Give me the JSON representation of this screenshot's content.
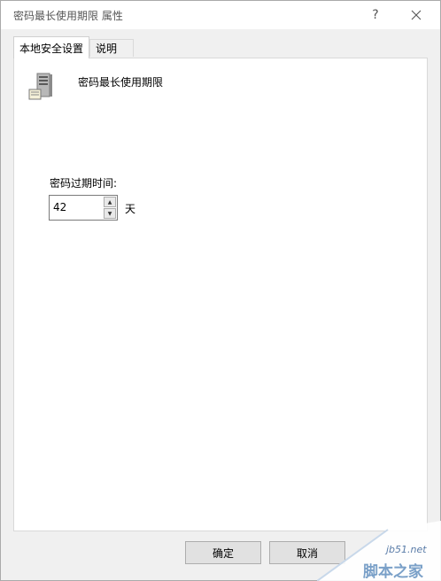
{
  "window": {
    "title": "密码最长使用期限 属性",
    "help_glyph": "?",
    "close_glyph": "✕"
  },
  "tabs": [
    {
      "label": "本地安全设置",
      "active": true
    },
    {
      "label": "说明",
      "active": false
    }
  ],
  "policy": {
    "icon": "server-icon",
    "name": "密码最长使用期限",
    "field_label": "密码过期时间:",
    "value": "42",
    "unit": "天"
  },
  "buttons": {
    "ok": "确定",
    "cancel": "取消"
  },
  "watermark": {
    "url": "jb51.net",
    "site_name": "脚本之家"
  },
  "colors": {
    "panel_bg": "#ffffff",
    "window_bg": "#f0f0f0",
    "watermark_blue": "#7aa0c8"
  }
}
